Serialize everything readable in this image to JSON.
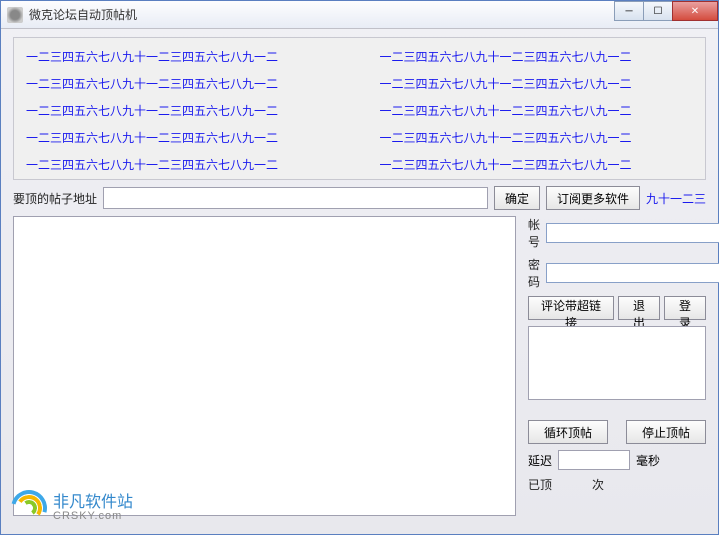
{
  "window": {
    "title": "微克论坛自动顶帖机"
  },
  "linkText": "一二三四五六七八九十一二三四五六七八九一二",
  "links": {
    "r0c0": "一二三四五六七八九十一二三四五六七八九一二",
    "r0c1": "一二三四五六七八九十一二三四五六七八九一二",
    "r1c0": "一二三四五六七八九十一二三四五六七八九一二",
    "r1c1": "一二三四五六七八九十一二三四五六七八九一二",
    "r2c0": "一二三四五六七八九十一二三四五六七八九一二",
    "r2c1": "一二三四五六七八九十一二三四五六七八九一二",
    "r3c0": "一二三四五六七八九十一二三四五六七八九一二",
    "r3c1": "一二三四五六七八九十一二三四五六七八九一二",
    "r4c0": "一二三四五六七八九十一二三四五六七八九一二",
    "r4c1": "一二三四五六七八九十一二三四五六七八九一二"
  },
  "address": {
    "label": "要顶的帖子地址",
    "value": "",
    "confirm": "确定",
    "subscribe": "订阅更多软件",
    "clipped": "九十一二三四"
  },
  "side": {
    "accountLabel": "帐号",
    "accountValue": "",
    "passwordLabel": "密码",
    "passwordValue": "",
    "commentLink": "评论带超链接",
    "logout": "退出",
    "login": "登录",
    "commentText": "",
    "loopBump": "循环顶帖",
    "stopBump": "停止顶帖",
    "delayLabel": "延迟",
    "delayValue": "",
    "delayUnit": "毫秒",
    "statusDone": "已顶",
    "statusTimes": "次"
  },
  "logo": {
    "cn": "非凡软件站",
    "en": "CRSKY.com"
  }
}
